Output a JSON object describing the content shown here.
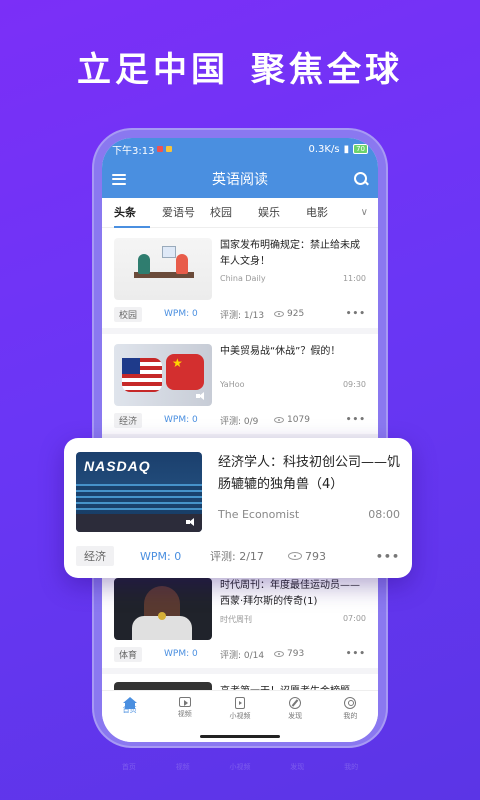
{
  "headline": {
    "left": "立足中国",
    "right": "聚焦全球"
  },
  "statusbar": {
    "time": "下午3:13",
    "network": "0.3K/s",
    "battery": "70"
  },
  "appbar": {
    "title": "英语阅读"
  },
  "tabs": [
    "头条",
    "爱语号",
    "校园",
    "娱乐",
    "电影"
  ],
  "articles": [
    {
      "title": "国家发布明确规定：禁止给未成年人文身！",
      "source": "China Daily",
      "time": "11:00",
      "tag": "校园",
      "wpm": "WPM: 0",
      "score": "评测: 1/13",
      "views": "925"
    },
    {
      "title": "中美贸易战“休战”？假的！",
      "source": "YaHoo",
      "time": "09:30",
      "tag": "经济",
      "wpm": "WPM: 0",
      "score": "评测: 0/9",
      "views": "1079"
    },
    {
      "title": "时代周刊：年度最佳运动员——西蒙·拜尔斯的传奇(1)",
      "source": "时代周刊",
      "time": "07:00",
      "tag": "体育",
      "wpm": "WPM: 0",
      "score": "评测: 0/14",
      "views": "793"
    }
  ],
  "partial_article": {
    "title": "高考第一天！诏愿考生金榜题"
  },
  "popout": {
    "title": "经济学人：科技初创公司——饥肠辘辘的独角兽（4）",
    "thumb_label": "NASDAQ",
    "source": "The Economist",
    "time": "08:00",
    "tag": "经济",
    "wpm": "WPM: 0",
    "score": "评测: 2/17",
    "views": "793"
  },
  "nav": [
    "首页",
    "视频",
    "小视频",
    "发现",
    "我的"
  ],
  "more_label": "•••"
}
